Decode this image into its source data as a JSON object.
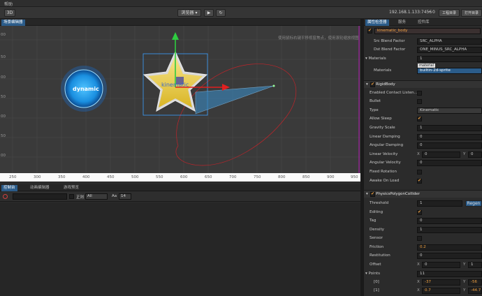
{
  "menu": {
    "item": "帮助"
  },
  "toolbar": {
    "mode_3d": "3D",
    "device_select": "浏览器 ▾",
    "play": "▶",
    "refresh": "↻",
    "ip": "192.168.1.133:7456",
    "wifi_count": "0",
    "project_btn": "工程目录",
    "open_btn": "打开目录"
  },
  "scene_panel": {
    "tab": "场景编辑器",
    "hint": "使用鼠标右键平移视窗焦点，使用滚轮缩放视图",
    "x_ticks": [
      "250",
      "300",
      "350",
      "400",
      "450",
      "500",
      "550",
      "600",
      "650",
      "700",
      "750",
      "800",
      "850",
      "900",
      "950"
    ],
    "y_ticks": [
      "00",
      "50",
      "00",
      "50",
      "00",
      "50",
      "00"
    ],
    "dynamic_label": "dynamic",
    "kinematic_label": "kinematic"
  },
  "console_panel": {
    "tabs": [
      "控制台",
      "动画编辑器",
      "游戏预览"
    ],
    "regex_label": "正则",
    "level_select": "All",
    "font_size": "14"
  },
  "inspector": {
    "tabs": [
      "属性检查器",
      "服务",
      "控件库"
    ],
    "node_name": "kinematic_body",
    "src_blend_label": "Src Blend Factor",
    "src_blend": "SRC_ALPHA",
    "dst_blend_label": "Dst Blend Factor",
    "dst_blend": "ONE_MINUS_SRC_ALPHA",
    "materials_label": "Materials",
    "materials_count": "1",
    "materials_sub_label": "Materials",
    "material_tag": "material",
    "material_value": "builtin-2d-sprite",
    "rigidbody_title": "RigidBody",
    "rb_rows": [
      {
        "label": "Enabled Contact Listen..."
      },
      {
        "label": "Bullet"
      },
      {
        "label": "Type",
        "value": "Kinematic"
      },
      {
        "label": "Allow Sleep"
      },
      {
        "label": "Gravity Scale",
        "value": "1"
      },
      {
        "label": "Linear Damping",
        "value": "0"
      },
      {
        "label": "Angular Damping",
        "value": "0"
      },
      {
        "label": "Linear Velocity",
        "x": "0",
        "y": "0"
      },
      {
        "label": "Angular Velocity",
        "value": "0"
      },
      {
        "label": "Fixed Rotation"
      },
      {
        "label": "Awake On Load"
      }
    ],
    "collider_title": "PhysicsPolygonCollider",
    "pc_rows": [
      {
        "label": "Threshold",
        "value": "1",
        "button": "Regen"
      },
      {
        "label": "Editing"
      },
      {
        "label": "Tag",
        "value": "0"
      },
      {
        "label": "Density",
        "value": "1"
      },
      {
        "label": "Sensor"
      },
      {
        "label": "Friction",
        "value": "0.2"
      },
      {
        "label": "Restitution",
        "value": "0"
      },
      {
        "label": "Offset",
        "x": "0",
        "y": "1"
      },
      {
        "label": "Points",
        "value": "11"
      },
      {
        "label": "[0]",
        "x": "-37",
        "y": "-56"
      },
      {
        "label": "[1]",
        "x": "0.7",
        "y": "-44.7"
      }
    ],
    "x_label": "X",
    "y_label": "Y",
    "colors": {
      "accent": "#f0a040",
      "selected": "#2b5c8a"
    }
  }
}
